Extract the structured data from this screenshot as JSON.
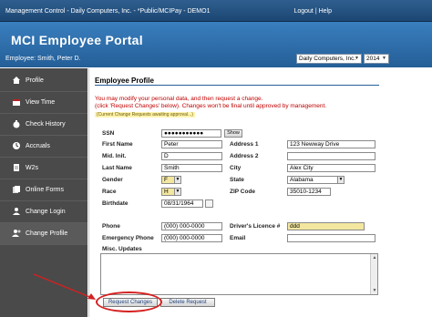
{
  "topbar": {
    "title": "Management Control - Daily Computers, Inc. - *Public/MCIPay - DEMO1",
    "logout": "Logout",
    "separator": " | ",
    "help": "Help"
  },
  "header": {
    "portal_title": "MCI Employee Portal",
    "employee": "Employee: Smith, Peter D.",
    "company_select": "Daily Computers, Inc.",
    "year_select": "2014"
  },
  "sidebar": {
    "items": [
      {
        "label": "Profile",
        "icon": "house-icon"
      },
      {
        "label": "View Time",
        "icon": "calendar-icon"
      },
      {
        "label": "Check History",
        "icon": "money-bag-icon"
      },
      {
        "label": "Accruals",
        "icon": "clock-icon"
      },
      {
        "label": "W2s",
        "icon": "document-icon"
      },
      {
        "label": "Online Forms",
        "icon": "forms-icon"
      },
      {
        "label": "Change Login",
        "icon": "person-icon"
      },
      {
        "label": "Change Profile",
        "icon": "person-settings-icon"
      }
    ]
  },
  "profile": {
    "title": "Employee Profile",
    "notice1": "You may modify your personal data, and then request a change.",
    "notice2": "(click 'Request Changes' below). Changes won't be final until approved by management.",
    "pending": "(Current Change Requests awaiting approval...)",
    "labels": {
      "ssn": "SSN",
      "first_name": "First Name",
      "mid_init": "Mid. Init.",
      "last_name": "Last Name",
      "gender": "Gender",
      "race": "Race",
      "birthdate": "Birthdate",
      "address1": "Address 1",
      "address2": "Address 2",
      "city": "City",
      "state": "State",
      "zip": "ZIP Code",
      "phone": "Phone",
      "emergency_phone": "Emergency Phone",
      "drivers_licence": "Driver's Licence #",
      "email": "Email",
      "misc_updates": "Misc. Updates"
    },
    "values": {
      "ssn": "●●●●●●●●●●●",
      "show_button": "Show",
      "first_name": "Peter",
      "mid_init": "D",
      "last_name": "Smith",
      "gender": "F",
      "race": "H",
      "birthdate": "08/31/1964",
      "address1": "123 Newway Drive",
      "address2": "",
      "city": "Alex City",
      "state": "Alabama",
      "zip": "35010-1234",
      "phone": "(000) 000-0000",
      "emergency_phone": "(000) 000-0000",
      "drivers_licence": "ddd",
      "email": ""
    },
    "buttons": {
      "request_changes": "Request Changes",
      "delete_request": "Delete Request"
    }
  },
  "colors": {
    "header_blue": "#245e97",
    "sidebar": "#4a4a4a",
    "notice_red": "#c00000",
    "highlight_red": "#d52020",
    "changed_field": "#f3e7a0"
  }
}
